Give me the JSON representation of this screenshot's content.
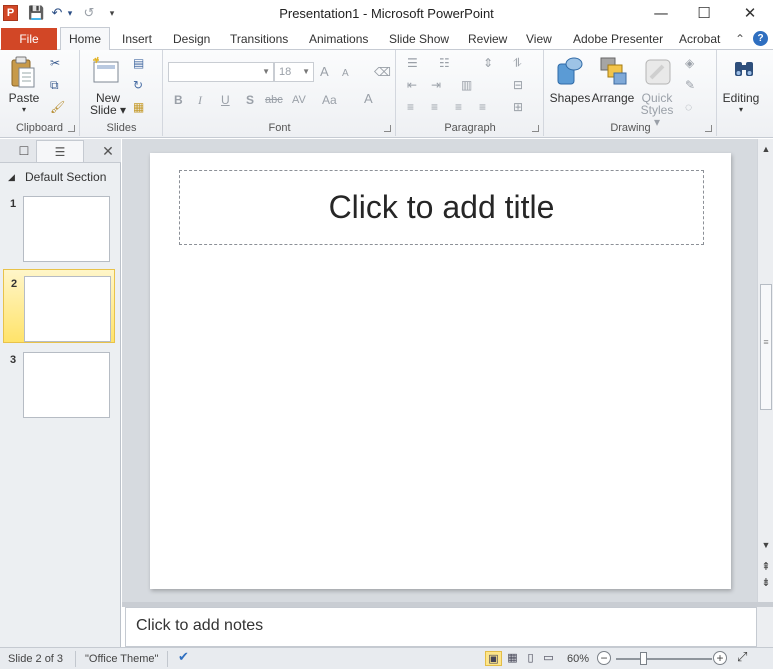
{
  "window": {
    "title": "Presentation1  -  Microsoft PowerPoint",
    "app_icon_letter": "P",
    "controls": {
      "minimize": "—",
      "maximize": "☐",
      "close": "✕"
    }
  },
  "qat": {
    "save": "💾",
    "undo": "↶",
    "undo_drop": "▾",
    "redo": "↺",
    "customize": "▾"
  },
  "tabs": {
    "file": "File",
    "home": "Home",
    "items": [
      "Insert",
      "Design",
      "Transitions",
      "Animations",
      "Slide Show",
      "Review",
      "View",
      "Adobe Presenter",
      "Acrobat"
    ],
    "collapse_icon": "⌃",
    "help_icon": "?"
  },
  "ribbon": {
    "clipboard": {
      "label": "Clipboard",
      "paste": "Paste",
      "paste_drop": "▾",
      "cut": "✂",
      "copy": "⧉",
      "format_painter": "🖌"
    },
    "slides": {
      "label": "Slides",
      "new_slide_line1": "New",
      "new_slide_line2": "Slide ▾",
      "layout": "▤",
      "reset": "↻",
      "section": "▦"
    },
    "font": {
      "label": "Font",
      "font_name": "",
      "font_size": "18",
      "grow": "A",
      "shrink": "A",
      "clear": "⌫",
      "bold": "B",
      "italic": "I",
      "underline": "U",
      "shadow": "S",
      "strike": "abc",
      "spacing": "AV",
      "case": "Aa",
      "color": "A"
    },
    "paragraph": {
      "label": "Paragraph",
      "bullets": "☰",
      "numbering": "☷",
      "line_spacing": "⇕",
      "text_direction": "⥮",
      "dec_indent": "⇤",
      "inc_indent": "⇥",
      "columns": "▥",
      "align_text": "⊟",
      "align_left": "≡",
      "center": "≡",
      "align_right": "≡",
      "justify": "≡",
      "smartart": "⊞"
    },
    "drawing": {
      "label": "Drawing",
      "shapes": "Shapes",
      "arrange": "Arrange",
      "quick_styles_1": "Quick",
      "quick_styles_2": "Styles ▾",
      "shape_fill": "◈",
      "shape_outline": "✎",
      "shape_effects": "◌"
    },
    "editing": {
      "label": "Editing",
      "icon": "🔍"
    }
  },
  "slides_pane": {
    "tab_slides": "☐",
    "tab_outline": "☰",
    "close": "✕",
    "section_name": "Default Section",
    "section_toggle": "◢",
    "slides": [
      {
        "number": "1",
        "selected": false
      },
      {
        "number": "2",
        "selected": true
      },
      {
        "number": "3",
        "selected": false
      }
    ]
  },
  "slide": {
    "title_placeholder": "Click to add title"
  },
  "notes": {
    "placeholder": "Click to add notes"
  },
  "scrollbar": {
    "up": "▲",
    "down": "▼",
    "prev_slide": "⇞",
    "next_slide": "⇟",
    "grip": "≡"
  },
  "status": {
    "slide_info": "Slide 2 of 3",
    "theme": "\"Office Theme\"",
    "spell_icon": "✔",
    "views": {
      "normal": "▣",
      "sorter": "▦",
      "reading": "▯",
      "slideshow": "▭"
    },
    "zoom_level": "60%",
    "zoom_value_percent": 60,
    "zoom_out": "−",
    "zoom_in": "+",
    "fit": "⤢"
  }
}
